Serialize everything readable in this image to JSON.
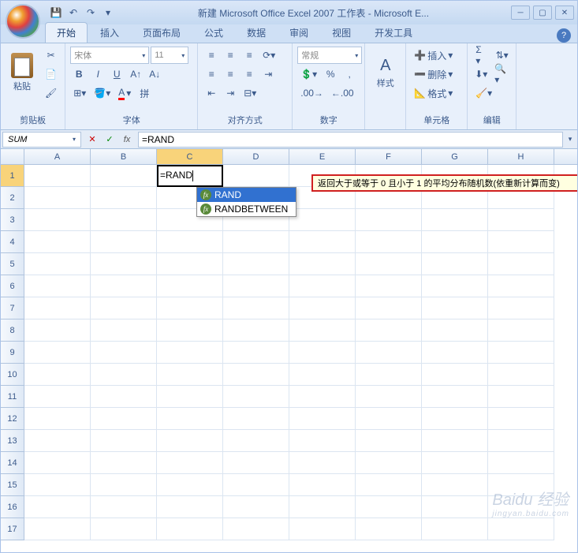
{
  "title": "新建 Microsoft Office Excel 2007 工作表 - Microsoft E...",
  "tabs": {
    "home": "开始",
    "insert": "插入",
    "layout": "页面布局",
    "formulas": "公式",
    "data": "数据",
    "review": "审阅",
    "view": "视图",
    "dev": "开发工具"
  },
  "groups": {
    "clipboard": {
      "label": "剪贴板",
      "paste": "粘贴"
    },
    "font": {
      "label": "字体",
      "fontname": "宋体",
      "fontsize": "11"
    },
    "align": {
      "label": "对齐方式"
    },
    "number": {
      "label": "数字",
      "format": "常规"
    },
    "styles": {
      "label": "样式",
      "btn": "样式"
    },
    "cells": {
      "label": "单元格",
      "insert": "插入",
      "delete": "删除",
      "format": "格式"
    },
    "editing": {
      "label": "编辑"
    }
  },
  "formula_bar": {
    "namebox": "SUM",
    "formula": "=RAND"
  },
  "columns": [
    "A",
    "B",
    "C",
    "D",
    "E",
    "F",
    "G",
    "H"
  ],
  "rows": [
    "1",
    "2",
    "3",
    "4",
    "5",
    "6",
    "7",
    "8",
    "9",
    "10",
    "11",
    "12",
    "13",
    "14",
    "15",
    "16",
    "17"
  ],
  "active_cell_value": "=RAND",
  "autocomplete": {
    "items": [
      {
        "name": "RAND"
      },
      {
        "name": "RANDBETWEEN"
      }
    ]
  },
  "tooltip": "返回大于或等于 0 且小于 1 的平均分布随机数(依重新计算而变)",
  "watermark": {
    "main": "Baidu 经验",
    "sub": "jingyan.baidu.com"
  }
}
